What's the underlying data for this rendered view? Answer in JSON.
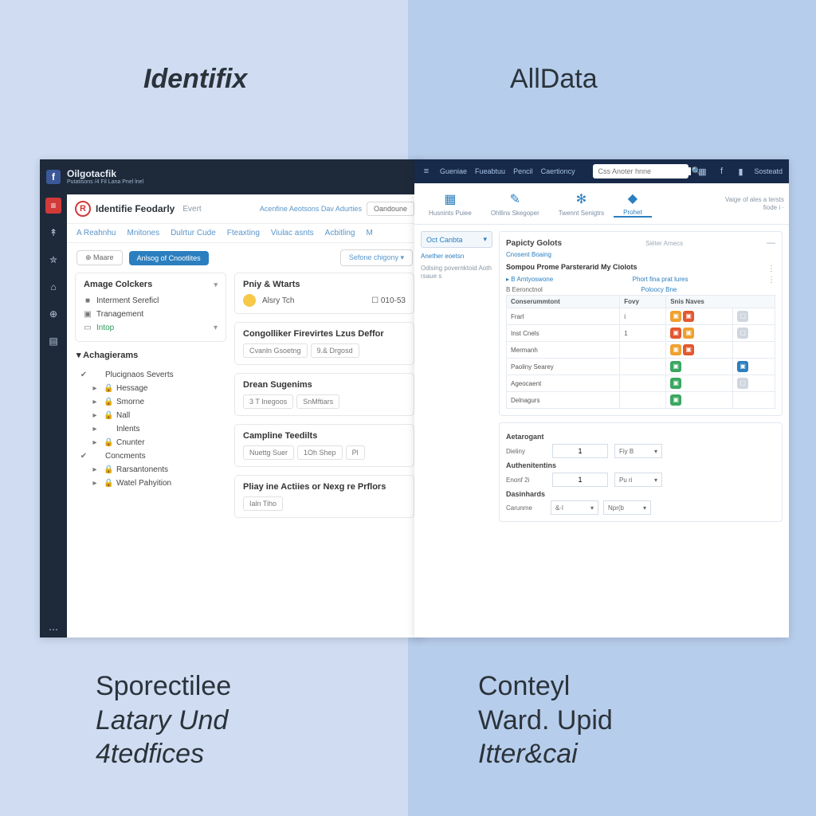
{
  "titles": {
    "left": "Identifix",
    "right": "AllData"
  },
  "captions": {
    "left_l1": "Sporectilee",
    "left_l2": "Latary Und",
    "left_l3": "4tedfices",
    "right_l1": "Conteyl",
    "right_l2": "Ward. Upid",
    "right_l3": "Itter&cai"
  },
  "identifix": {
    "brand_name": "Oilgotacfik",
    "brand_sub": "Putatisons /4 Fil Lana Pnel lnel",
    "header_title": "Identifie Feodarly",
    "header_kind": "Evert",
    "header_link": "Acenfine Aeotsons Dav Adurties",
    "header_btn": "Oandoune",
    "tabs": [
      "A Reahnhu",
      "Mnitones",
      "Dulrtur Cude",
      "Fteaxting",
      "Viulac asnts",
      "Acbitling",
      "M"
    ],
    "more_label": "⊕ Maare",
    "pill_label": "Anlsog of Cnootlites",
    "select_label": "Sefone chigony",
    "side_card1_title": "Amage Colckers",
    "side_card1_items": [
      {
        "icon": "■",
        "label": "Interment Sereficl"
      },
      {
        "icon": "▣",
        "label": "Tranagement"
      },
      {
        "icon": "▭",
        "label": "Intop",
        "green": true,
        "chev": true
      }
    ],
    "side_group_title": "Achagierams",
    "side_group_items": [
      {
        "icon": "✔",
        "label": "Plucignaos Severts",
        "sub": false
      },
      {
        "icon": "▸",
        "label": "Hessage",
        "sub": true,
        "lock": true
      },
      {
        "icon": "▸",
        "label": "Smorne",
        "sub": true,
        "lock": true
      },
      {
        "icon": "▸",
        "label": "Nall",
        "sub": true,
        "lock": true
      },
      {
        "icon": "▸",
        "label": "Inlents",
        "sub": true
      },
      {
        "icon": "▸",
        "label": "Cnunter",
        "sub": true,
        "lock": true
      },
      {
        "icon": "✔",
        "label": "Concments",
        "sub": false
      },
      {
        "icon": "▸",
        "label": "Rarsantonents",
        "sub": true,
        "lock": true
      },
      {
        "icon": "▸",
        "label": "Watel Pahyition",
        "sub": true,
        "lock": true
      }
    ],
    "feed": [
      {
        "title": "Pniy & Wtarts",
        "type": "avatar",
        "name": "Alsry Tch",
        "check": "010-53"
      },
      {
        "title": "Congolliker Firevirtes Lzus Deffor",
        "type": "chips",
        "chips": [
          "Cvanln Gsoetng",
          "9.& Drgosd"
        ]
      },
      {
        "title": "Drean Sugenims",
        "type": "chips",
        "chips": [
          "3 T Inegoos",
          "SnMftiars"
        ]
      },
      {
        "title": "Campline Teedilts",
        "type": "chips",
        "chips": [
          "Nuettg Suer",
          "1Oh Shep",
          "Pl"
        ]
      },
      {
        "title": "Pliay ine Actiies or Nexg re Prflors",
        "type": "chips",
        "chips": [
          "Ialn Tiho"
        ]
      }
    ]
  },
  "alldata": {
    "topmenu": [
      "Gueniae",
      "Fueabtuu",
      "Pencil",
      "Caertioncy"
    ],
    "search_placeholder": "Css Anoter hnne",
    "top_right_label": "Sosteatd",
    "tabs": [
      {
        "icon": "▦",
        "label": "Husnints Puiee"
      },
      {
        "icon": "✎",
        "label": "Ohllins Skegoper"
      },
      {
        "icon": "✻",
        "label": "Twennt Senigtrs"
      },
      {
        "icon": "◆",
        "label": "Prohet",
        "active": true
      }
    ],
    "tab_note_l1": "Vaige of ales a tersts",
    "tab_note_l2": "fiode i ·",
    "left_dd": "Oct Canbta",
    "left_link": "Anether eoetsn",
    "left_mut": "Odising povernktoid Aoth rsaue s",
    "panel1": {
      "title": "Papicty Golots",
      "sub": "Siéter Amecs",
      "line1": "Cnosent Boaing",
      "strong": "Sompou Prome Parsterarid My Ciolots",
      "links_row": [
        "B Amtyoswone",
        "Phort fina prat lures"
      ],
      "links_row2": [
        "B Eeronctnol",
        "Poloocy Bne"
      ],
      "th": [
        "Conserummtont",
        "Fovy",
        "Snis Naves"
      ],
      "rows": [
        {
          "c0": "Frarl",
          "c1": "i",
          "sq": [
            "sq-o",
            "sq-r"
          ],
          "last": "sq-gr"
        },
        {
          "c0": "Inst Cnels",
          "c1": "1",
          "sq": [
            "sq-r",
            "sq-o"
          ],
          "last": "sq-gr"
        },
        {
          "c0": "Mermanh",
          "c1": "",
          "sq": [
            "sq-o",
            "sq-r"
          ],
          "last": ""
        },
        {
          "c0": "Paoliny Searey",
          "c1": "",
          "sq": [
            "sq-g"
          ],
          "last": "sq-b",
          "blue_only": true
        },
        {
          "c0": "Ageocaent",
          "c1": "",
          "sq": [
            "sq-g"
          ],
          "last": "sq-gr"
        },
        {
          "c0": "Delnagurs",
          "c1": "",
          "sq": [
            "sq-g"
          ],
          "last": ""
        }
      ]
    },
    "sections": {
      "s1_title": "Aetarogant",
      "s1_label": "Dieliny",
      "s1_val": "1",
      "s1_sel": "Fiy B",
      "s2_title": "Authenitentins",
      "s2_label": "Enonf 2i",
      "s2_val": "1",
      "s2_sel": "Pu ri",
      "s3_title": "Dasinhards",
      "s3_label": "Carunme",
      "s3_sel1": "&·l",
      "s3_sel2": "Npr(b"
    }
  }
}
